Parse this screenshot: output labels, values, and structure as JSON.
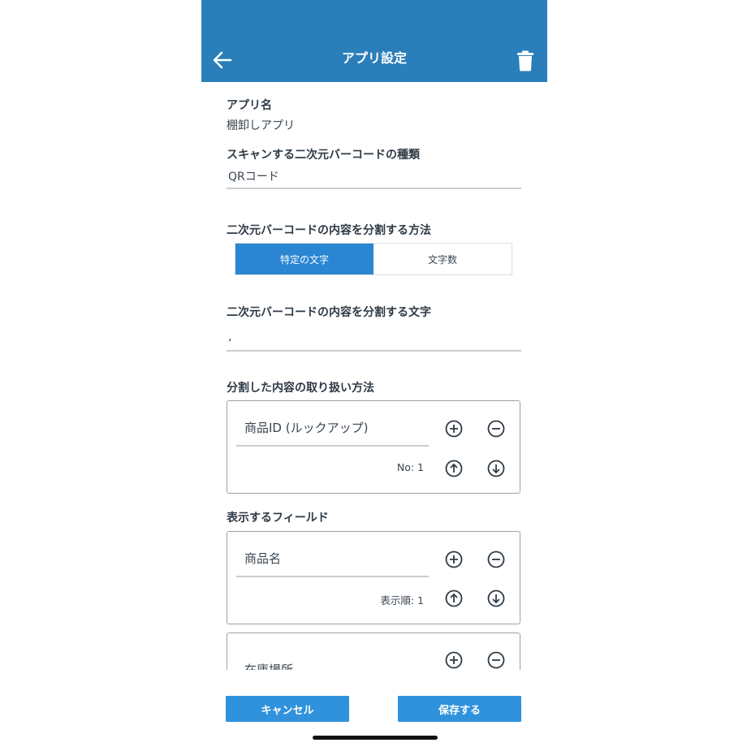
{
  "header": {
    "title": "アプリ設定",
    "back_icon": "arrow-left-icon",
    "delete_icon": "trash-icon"
  },
  "app_name": {
    "label": "アプリ名",
    "value": "棚卸しアプリ"
  },
  "barcode_type": {
    "label": "スキャンする二次元バーコードの種類",
    "value": "QRコード"
  },
  "split_method": {
    "label": "二次元バーコードの内容を分割する方法",
    "options": [
      "特定の文字",
      "文字数"
    ],
    "selected": "特定の文字"
  },
  "split_char": {
    "label": "二次元バーコードの内容を分割する文字",
    "value": ","
  },
  "handling": {
    "label": "分割した内容の取り扱い方法",
    "items": [
      {
        "field": "商品ID (ルックアップ)",
        "order_text": "No: 1"
      }
    ]
  },
  "display_fields": {
    "label": "表示するフィールド",
    "items": [
      {
        "field": "商品名",
        "order_text": "表示順: 1"
      },
      {
        "field": "在庫場所"
      }
    ]
  },
  "footer": {
    "cancel_label": "キャンセル",
    "save_label": "保存する"
  },
  "colors": {
    "primary": "#2a7fba",
    "button": "#3092dc",
    "segment_active": "#2a86d3"
  }
}
